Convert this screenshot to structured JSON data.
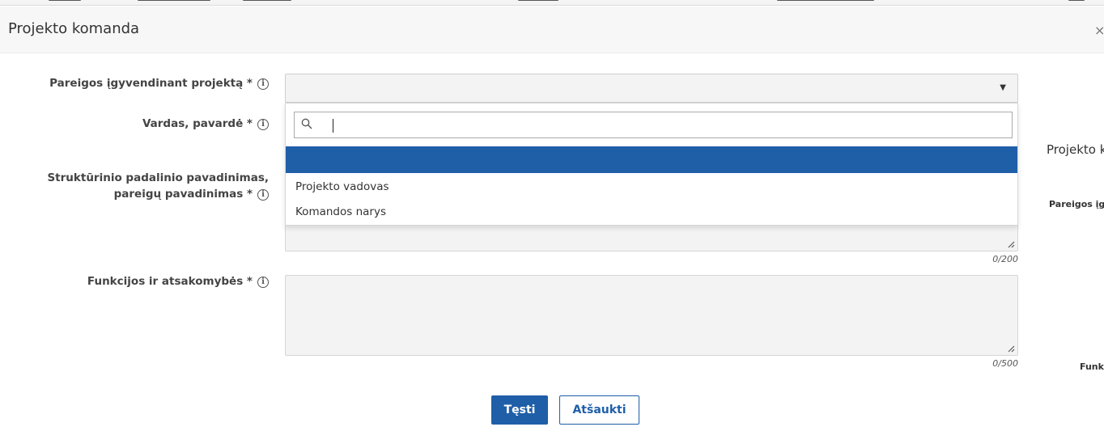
{
  "modal": {
    "title": "Projekto komanda",
    "close_label": "×"
  },
  "form": {
    "duties": {
      "label": "Pareigos įgyvendinant projektą *",
      "info_icon": "ⓘ",
      "selected_value": "",
      "dropdown": {
        "search_value": "",
        "options": [
          "",
          "Projekto vadovas",
          "Komandos narys"
        ]
      }
    },
    "name": {
      "label": "Vardas, pavardė *",
      "info_icon": "ⓘ"
    },
    "unit": {
      "label_line1": "Struktūrinio padalinio pavadinimas,",
      "label_line2": "pareigų pavadinimas *",
      "info_icon": "ⓘ",
      "counter": "0/200"
    },
    "functions": {
      "label": "Funkcijos ir atsakomybės *",
      "info_icon": "ⓘ",
      "counter": "0/500"
    }
  },
  "buttons": {
    "submit_label": "Tęsti",
    "cancel_label": "Atšaukti"
  },
  "background": {
    "title_fragment": "Projekto k",
    "label_fragment": "Pareigos įg",
    "label_fragment2": "Funk"
  },
  "colors": {
    "primary": "#1f5fa8",
    "header_bg": "#f7f7f7",
    "field_bg": "#f3f3f3"
  },
  "icons": {
    "search": "search-icon",
    "dropdown": "triangle-down-icon",
    "info": "info-circle-icon",
    "resize": "resize-handle-icon",
    "close": "close-icon"
  }
}
